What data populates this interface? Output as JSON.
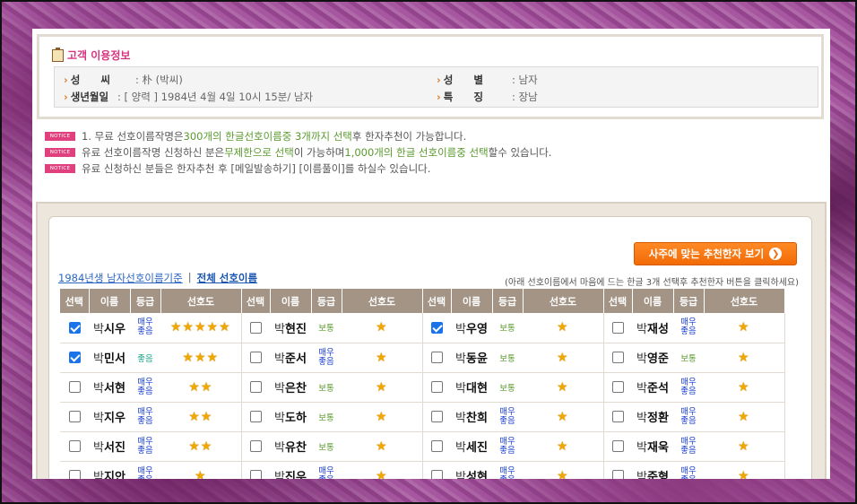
{
  "info": {
    "title": "고객 이용정보",
    "rows": [
      {
        "label": "성　　씨",
        "value": ": 朴 (박씨)"
      },
      {
        "label": "생년월일",
        "value": ": [ 양력 ] 1984년 4월 4일 10시 15분/ 남자"
      },
      {
        "label": "성　　별",
        "value": ": 남자"
      },
      {
        "label": "특　　징",
        "value": ": 장남"
      }
    ]
  },
  "notices": {
    "badge": "NOTICE",
    "n1_a": "1. 무료 선호이름작명은 ",
    "n1_b": "300개의 한글선호이름중 3개까지 선택",
    "n1_c": "후 한자추천이 가능합니다.",
    "n2_a": "유료 선호이름작명 신청하신 분은",
    "n2_b": "무제한으로 선택",
    "n2_c": "이 가능하며 ",
    "n2_d": "1,000개의 한글 선호이름중 선택",
    "n2_e": "할수 있습니다.",
    "n3": "유료 신청하신 분들은 한자추천 후 [메일발송하기] [이름풀이]를 하실수 있습니다."
  },
  "panel": {
    "button_label": "사주에 맞는 추천한자 보기",
    "crumb_link": "1984년생 남자선호이름기준",
    "crumb_sep": "|",
    "crumb_all": "전체 선호이름",
    "hint": "(아래 선호이름에서 마음에 드는 한글 3개 선택후 추천한자 버튼을 클릭하세요)",
    "headers": [
      "선택",
      "이름",
      "등급",
      "선호도"
    ]
  },
  "colors": {
    "accent": "#f26a06",
    "header_bg": "#a39486",
    "notice_badge": "#e0417e"
  },
  "grade_labels": {
    "very_good": "매우좋음",
    "good": "좋음",
    "normal": "보통"
  },
  "rows": [
    [
      {
        "surname": "박",
        "given": "시우",
        "grade": "매우좋음",
        "stars": 5,
        "checked": true
      },
      {
        "surname": "박",
        "given": "현진",
        "grade": "보통",
        "stars": 1,
        "checked": false
      },
      {
        "surname": "박",
        "given": "우영",
        "grade": "보통",
        "stars": 1,
        "checked": true
      },
      {
        "surname": "박",
        "given": "재성",
        "grade": "매우좋음",
        "stars": 1,
        "checked": false
      }
    ],
    [
      {
        "surname": "박",
        "given": "민서",
        "grade": "좋음",
        "stars": 3,
        "checked": true
      },
      {
        "surname": "박",
        "given": "준서",
        "grade": "매우좋음",
        "stars": 1,
        "checked": false
      },
      {
        "surname": "박",
        "given": "동윤",
        "grade": "보통",
        "stars": 1,
        "checked": false
      },
      {
        "surname": "박",
        "given": "영준",
        "grade": "보통",
        "stars": 1,
        "checked": false
      }
    ],
    [
      {
        "surname": "박",
        "given": "서현",
        "grade": "매우좋음",
        "stars": 2,
        "checked": false
      },
      {
        "surname": "박",
        "given": "은찬",
        "grade": "보통",
        "stars": 1,
        "checked": false
      },
      {
        "surname": "박",
        "given": "대현",
        "grade": "보통",
        "stars": 1,
        "checked": false
      },
      {
        "surname": "박",
        "given": "준석",
        "grade": "매우좋음",
        "stars": 1,
        "checked": false
      }
    ],
    [
      {
        "surname": "박",
        "given": "지우",
        "grade": "매우좋음",
        "stars": 2,
        "checked": false
      },
      {
        "surname": "박",
        "given": "도하",
        "grade": "보통",
        "stars": 1,
        "checked": false
      },
      {
        "surname": "박",
        "given": "찬희",
        "grade": "매우좋음",
        "stars": 1,
        "checked": false
      },
      {
        "surname": "박",
        "given": "정환",
        "grade": "매우좋음",
        "stars": 1,
        "checked": false
      }
    ],
    [
      {
        "surname": "박",
        "given": "서진",
        "grade": "매우좋음",
        "stars": 2,
        "checked": false
      },
      {
        "surname": "박",
        "given": "유찬",
        "grade": "보통",
        "stars": 1,
        "checked": false
      },
      {
        "surname": "박",
        "given": "세진",
        "grade": "매우좋음",
        "stars": 1,
        "checked": false
      },
      {
        "surname": "박",
        "given": "재욱",
        "grade": "매우좋음",
        "stars": 1,
        "checked": false
      }
    ],
    [
      {
        "surname": "박",
        "given": "지안",
        "grade": "매우좋음",
        "stars": 1,
        "checked": false
      },
      {
        "surname": "박",
        "given": "진우",
        "grade": "매우좋음",
        "stars": 1,
        "checked": false
      },
      {
        "surname": "박",
        "given": "성현",
        "grade": "매우좋음",
        "stars": 1,
        "checked": false
      },
      {
        "surname": "박",
        "given": "준형",
        "grade": "매우좋음",
        "stars": 1,
        "checked": false
      }
    ]
  ]
}
